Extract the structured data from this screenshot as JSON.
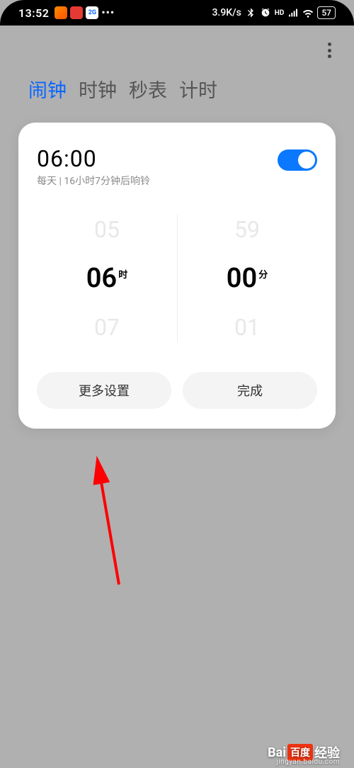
{
  "statusBar": {
    "time": "13:52",
    "netSpeed": "3.9K/s",
    "hd": "HD",
    "battery": "57"
  },
  "tabs": {
    "alarm": "闹钟",
    "clock": "时钟",
    "stopwatch": "秒表",
    "timer": "计时"
  },
  "alarm": {
    "time": "06:00",
    "sub": "每天 | 16小时7分钟后响铃"
  },
  "picker": {
    "hour_prev": "05",
    "hour_sel": "06",
    "hour_unit": "时",
    "hour_next": "07",
    "min_prev": "59",
    "min_sel": "00",
    "min_unit": "分",
    "min_next": "01"
  },
  "buttons": {
    "more": "更多设置",
    "done": "完成"
  },
  "watermark": {
    "brand_pre": "Bai",
    "brand_mid": "百度",
    "brand_post": "经验",
    "url": "jingyan.baidu.com"
  }
}
